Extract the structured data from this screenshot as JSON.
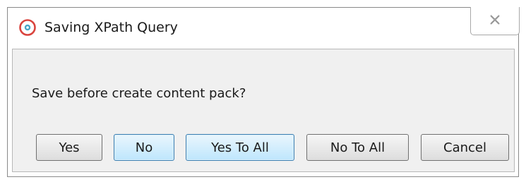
{
  "window": {
    "title": "Saving XPath Query",
    "app_icon": "app-logo-icon",
    "close_icon": "close-x-icon"
  },
  "message": "Save before create content pack?",
  "buttons": {
    "yes": "Yes",
    "no": "No",
    "yes_to_all": "Yes To All",
    "no_to_all": "No To All",
    "cancel": "Cancel"
  },
  "colors": {
    "app_icon": "#d9443e",
    "focused_button_border": "#3c7fb1"
  }
}
